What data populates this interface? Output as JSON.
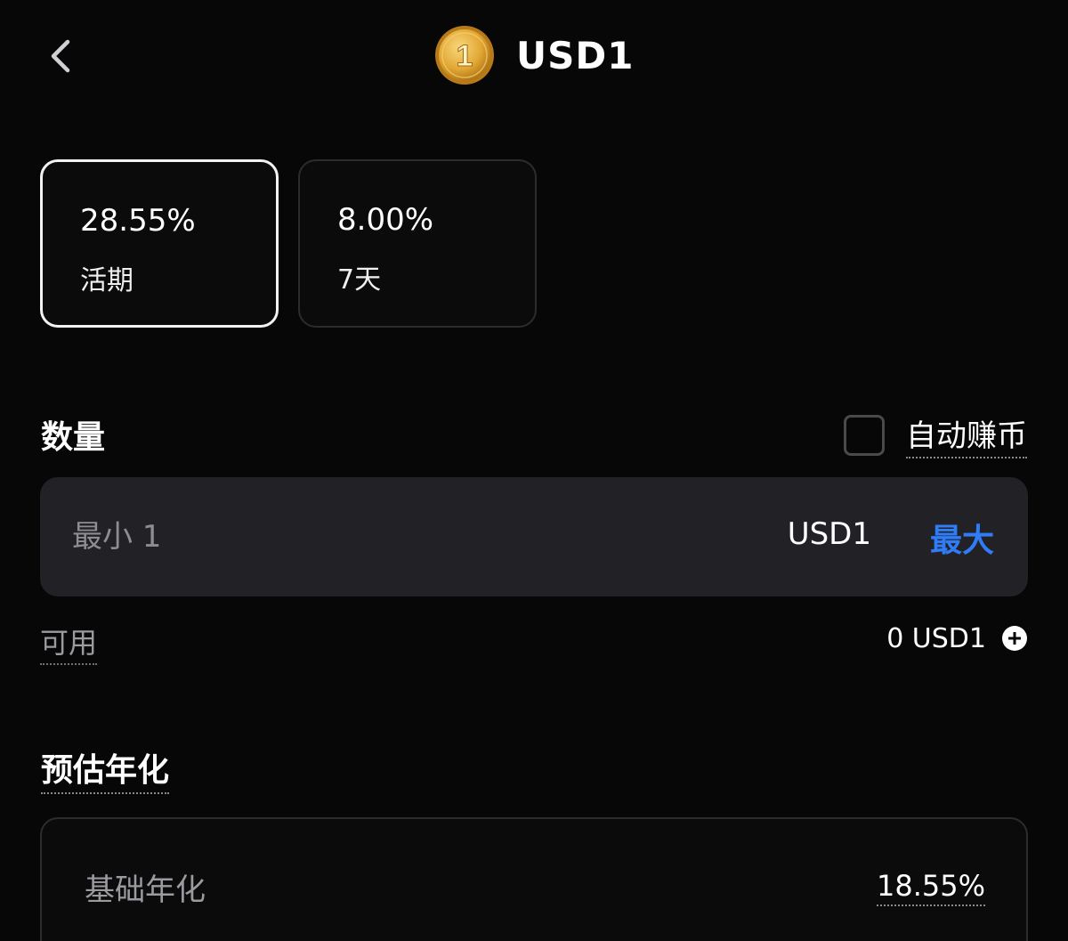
{
  "header": {
    "title": "USD1",
    "coin_glyph": "1",
    "back_icon": "chevron-left-icon",
    "coin_icon": "usd1-coin-icon"
  },
  "terms": [
    {
      "rate": "28.55%",
      "label": "活期",
      "selected": true
    },
    {
      "rate": "8.00%",
      "label": "7天",
      "selected": false
    }
  ],
  "amount": {
    "label": "数量",
    "auto_earn_label": "自动赚币",
    "auto_earn_checked": false,
    "placeholder": "最小 1",
    "unit": "USD1",
    "max_label": "最大"
  },
  "available": {
    "label": "可用",
    "value": "0 USD1"
  },
  "estimate": {
    "label": "预估年化",
    "base_label": "基础年化",
    "base_value": "18.55%"
  },
  "colors": {
    "background": "#070707",
    "accent": "#2f7cf6",
    "input_bg": "#222226",
    "coin_gold": "#e2a735"
  }
}
